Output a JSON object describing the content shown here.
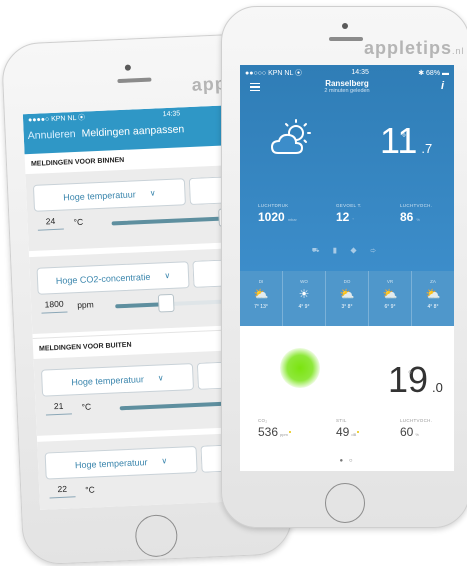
{
  "brand": {
    "left": "apple",
    "right": "appletips",
    "right_suffix": ".nl"
  },
  "left_phone": {
    "status": {
      "carrier": "●●●●○ KPN NL ⦿",
      "time": "14:35"
    },
    "nav": {
      "cancel": "Annuleren",
      "title": "Meldingen aanpassen"
    },
    "sections": {
      "inside": "MELDINGEN VOOR BINNEN",
      "outside": "MELDINGEN VOOR BUITEN"
    },
    "alerts": [
      {
        "label": "Hoge temperatuur",
        "value": "24",
        "unit": "°C",
        "level": 0.72
      },
      {
        "label": "Hoge CO2-concentratie",
        "value": "1800",
        "unit": "ppm",
        "level": 0.32
      },
      {
        "label": "Hoge temperatuur",
        "value": "21",
        "unit": "°C",
        "level": 0.7
      },
      {
        "label": "Hoge temperatuur",
        "value": "22",
        "unit": "°C"
      }
    ]
  },
  "right_phone": {
    "status": {
      "carrier": "●●○○○ KPN NL ⦿",
      "time": "14:35",
      "battery": "✱ 68% ▬"
    },
    "location": "Ranselberg",
    "updated": "2 minuten geleden",
    "outdoor": {
      "temp": "11",
      "decimal": ".7",
      "deg": "°"
    },
    "stats": [
      {
        "label": "LUCHTDRUK",
        "value": "1020",
        "unit": "mbar"
      },
      {
        "label": "GEVOEL T.",
        "value": "12",
        "unit": "°"
      },
      {
        "label": "LUCHTVOCH.",
        "value": "86",
        "unit": "%"
      }
    ],
    "mini_icons": "⛟ ▮ ◆ ⇨",
    "forecast": [
      {
        "day": "DI",
        "icon": "⛅",
        "temps": "7° 13°"
      },
      {
        "day": "WO",
        "icon": "☀",
        "temps": "4° 9°"
      },
      {
        "day": "DO",
        "icon": "⛅",
        "temps": "3° 8°"
      },
      {
        "day": "VR",
        "icon": "⛅",
        "temps": "6° 9°"
      },
      {
        "day": "ZA",
        "icon": "⛅",
        "temps": "4° 8°"
      }
    ],
    "indoor": {
      "temp": "19",
      "decimal": ".0",
      "deg": "°",
      "stats": [
        {
          "label": "CO₂",
          "value": "536",
          "unit": "ppm"
        },
        {
          "label": "STIL",
          "value": "49",
          "unit": "dB"
        },
        {
          "label": "LUCHTVOCH.",
          "value": "60",
          "unit": "%"
        }
      ]
    },
    "page_dots": "● ○"
  },
  "colors": {
    "accent": "#2f97c6",
    "slider": "#5e8f9f",
    "weather_bg": "#2f7db6",
    "co2_blob": "#7be40f"
  }
}
